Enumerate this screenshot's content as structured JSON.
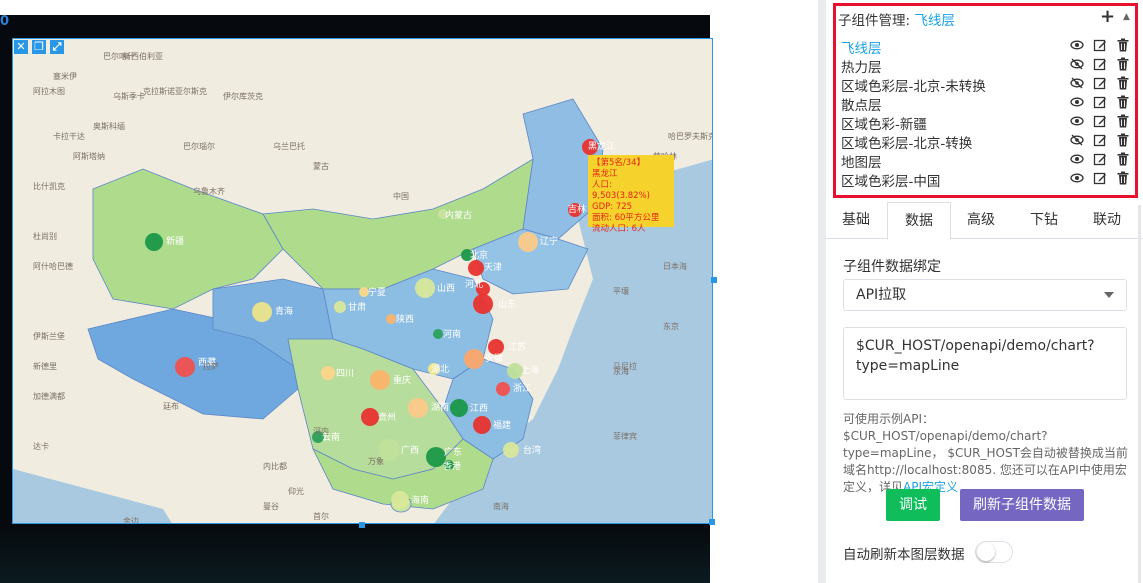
{
  "canvas": {
    "ruler_label": "0",
    "frame_tools": [
      {
        "icon": "close-icon",
        "glyph": "✕"
      },
      {
        "icon": "copy-icon",
        "glyph": "❐"
      },
      {
        "icon": "fullscreen-icon",
        "glyph": "⤢"
      }
    ]
  },
  "map": {
    "region_labels": [
      {
        "name": "新疆",
        "dot_color": "#1a9848"
      },
      {
        "name": "西藏",
        "dot_color": "#f0514f"
      },
      {
        "name": "青海",
        "dot_color": "#ece48a"
      },
      {
        "name": "甘肃",
        "dot_color": "#d8e89a"
      },
      {
        "name": "内蒙古",
        "dot_color": "#c8e4a0"
      },
      {
        "name": "黑龙江",
        "dot_color": "#e8332f"
      },
      {
        "name": "吉林",
        "dot_color": "#e8332f"
      },
      {
        "name": "辽宁",
        "dot_color": "#fbc98a"
      },
      {
        "name": "北京",
        "dot_color": "#1a9848"
      },
      {
        "name": "天津",
        "dot_color": "#e8332f"
      },
      {
        "name": "河北",
        "dot_color": "#e8332f"
      },
      {
        "name": "山西",
        "dot_color": "#d8e89a"
      },
      {
        "name": "宁夏",
        "dot_color": "#fbd989"
      },
      {
        "name": "陕西",
        "dot_color": "#fbb36a"
      },
      {
        "name": "山东",
        "dot_color": "#e8332f"
      },
      {
        "name": "河南",
        "dot_color": "#2ba05a"
      },
      {
        "name": "江苏",
        "dot_color": "#e8332f"
      },
      {
        "name": "安徽",
        "dot_color": "#fba66a"
      },
      {
        "name": "上海",
        "dot_color": "#bfe09a"
      },
      {
        "name": "湖北",
        "dot_color": "#f3e890"
      },
      {
        "name": "四川",
        "dot_color": "#fbd489"
      },
      {
        "name": "重庆",
        "dot_color": "#fbb36a"
      },
      {
        "name": "浙江",
        "dot_color": "#f0514f"
      },
      {
        "name": "湖南",
        "dot_color": "#fbc98a"
      },
      {
        "name": "江西",
        "dot_color": "#1a9848"
      },
      {
        "name": "贵州",
        "dot_color": "#e8332f"
      },
      {
        "name": "福建",
        "dot_color": "#e8332f"
      },
      {
        "name": "云南",
        "dot_color": "#2ba05a"
      },
      {
        "name": "广西",
        "dot_color": "#bfe09a"
      },
      {
        "name": "广东",
        "dot_color": "#1a9848"
      },
      {
        "name": "台湾",
        "dot_color": "#d8e89a"
      },
      {
        "name": "香港",
        "dot_color": "#1a9848"
      },
      {
        "name": "海南",
        "dot_color": "#d8e89a"
      }
    ],
    "basemap_labels": [
      "巴尔喀什",
      "阿拉木图",
      "比什凯克",
      "杜尚别",
      "阿什哈巴德",
      "伊斯兰堡",
      "新德里",
      "加德满都",
      "达卡",
      "廷布",
      "内比都",
      "仰光",
      "河内",
      "万象",
      "曼谷",
      "金边",
      "马尼拉",
      "首尔",
      "平壤",
      "东京",
      "萨哈林",
      "哈巴罗夫斯克",
      "伊尔库茨克",
      "乌兰巴托",
      "乌鲁木齐",
      "拉萨",
      "克拉斯诺亚尔斯克",
      "新西伯利亚",
      "巴尔瑙尔",
      "塞米伊",
      "奥斯科缅",
      "乌斯季卡",
      "卡拉干达",
      "阿斯塔纳",
      "东海",
      "南海",
      "中国",
      "蒙古",
      "日本海",
      "菲律宾"
    ],
    "tooltip": {
      "lines": [
        "【第5名/34】",
        "黑龙江",
        "人口: 9,503(3.82%)",
        "GDP: 725",
        "面积: 60平方公里",
        "流动人口: 6人"
      ]
    }
  },
  "layer_panel": {
    "title_prefix": "子组件管理:",
    "current_layer": "飞线层",
    "add_icon": "plus-icon",
    "collapse_icon": "caret-up-icon",
    "items": [
      {
        "label": "飞线层",
        "visible": true,
        "active": true
      },
      {
        "label": "热力层",
        "visible": false,
        "active": false
      },
      {
        "label": "区域色彩层-北京-未转换",
        "visible": false,
        "active": false
      },
      {
        "label": "散点层",
        "visible": true,
        "active": false
      },
      {
        "label": "区域色彩-新疆",
        "visible": true,
        "active": false
      },
      {
        "label": "区域色彩层-北京-转换",
        "visible": false,
        "active": false
      },
      {
        "label": "地图层",
        "visible": true,
        "active": false
      },
      {
        "label": "区域色彩层-中国",
        "visible": true,
        "active": false
      }
    ]
  },
  "tabs": [
    {
      "label": "基础",
      "active": false
    },
    {
      "label": "数据",
      "active": true
    },
    {
      "label": "高级",
      "active": false
    },
    {
      "label": "下钻",
      "active": false
    },
    {
      "label": "联动",
      "active": false
    }
  ],
  "data_binding": {
    "section_title": "子组件数据绑定",
    "source_selected": "API拉取",
    "api_value": "$CUR_HOST/openapi/demo/chart?type=mapLine",
    "help_text": "可使用示例API：$CUR_HOST/openapi/demo/chart?type=mapLine， $CUR_HOST会自动被替换成当前域名http://localhost:8085. 您还可以在API中使用宏定义，详见",
    "help_link": "API宏定义",
    "debug_button": "调试",
    "refresh_button": "刷新子组件数据",
    "auto_refresh_label": "自动刷新本图层数据",
    "auto_refresh_on": false
  },
  "colors": {
    "accent": "#1ba2e6",
    "highlight_border": "#e8112d",
    "debug_button": "#0fbd5b",
    "refresh_button": "#7466c1",
    "tooltip_bg": "#f6d22c",
    "tooltip_text": "#e2231a"
  }
}
